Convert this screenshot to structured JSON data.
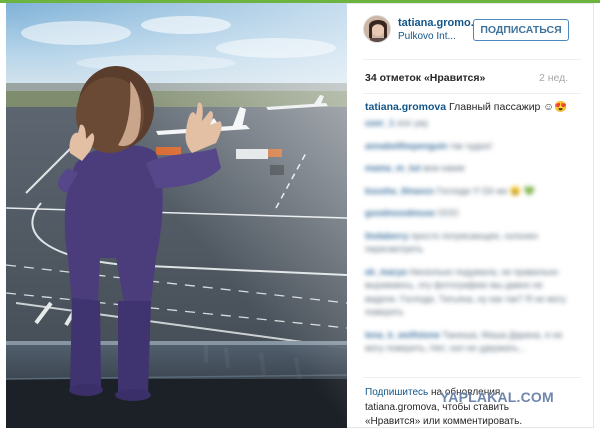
{
  "post": {
    "username": "tatiana.gromo...",
    "location": "Pulkovo Int...",
    "follow_label": "ПОДПИСАТЬСЯ",
    "likes": "34 отметок «Нравится»",
    "time": "2 нед.",
    "caption_user": "tatiana.gromova",
    "caption_text": "Главный пассажир ☺😍"
  },
  "comments_blurred": [
    {
      "user": "user_1",
      "text": "ooo yay"
    },
    {
      "user": "annabelthepenguin",
      "text": "так чудно!"
    },
    {
      "user": "mama_m_tut",
      "text": "мои какие"
    },
    {
      "user": "ksusha_ilinaxxx",
      "text": "Господи !!! Её же 😮 💚"
    },
    {
      "user": "goodmoodmuse",
      "text": "ООО"
    },
    {
      "user": "lindaberry",
      "text": "просто потрясающее, склонен пересмотреть"
    },
    {
      "user": "ek_marya",
      "text": "Нисколько подумала, не правильно выражаюсь, эту фотографию мы давно не видели. Господи, Татьяна, ну как так? Я не могу поверить"
    },
    {
      "user": "lena_k_wolfstone",
      "text": "Танюша, Маша Дарина, я не могу поверить, Нет, сил не удержать..."
    }
  ],
  "login_prompt": {
    "line1_pre": "Подпишитесь",
    "line1_link": "на обновления",
    "line2": "tatiana.gromova, чтобы ставить",
    "line3": "«Нравится» или комментировать."
  },
  "watermark": "YAPLAKAL.COM",
  "colors": {
    "link": "#125688",
    "follow_border": "#4a87c3",
    "muted": "#a5a7aa",
    "top_strip": "#6db33f"
  },
  "icons": {
    "avatar": "avatar-image",
    "pin": "location-pin-icon"
  }
}
